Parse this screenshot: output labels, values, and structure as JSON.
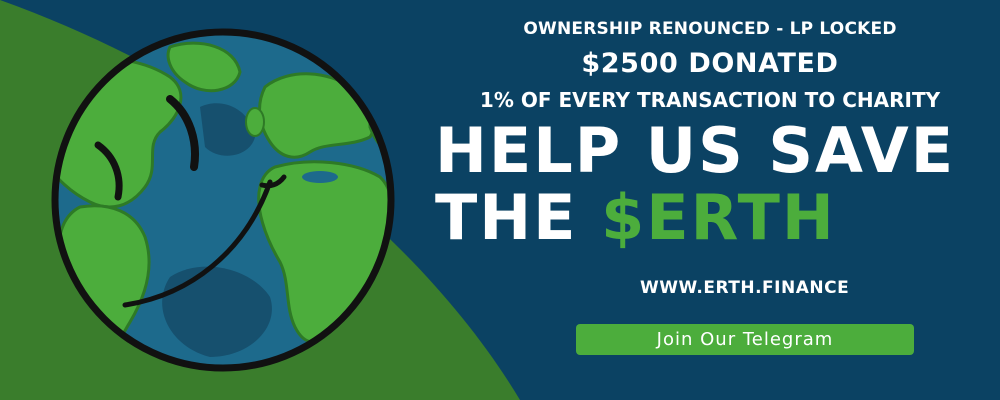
{
  "banner": {
    "ownership_line": "OWNERSHIP RENOUNCED - LP LOCKED",
    "donated_line": "$2500 DONATED",
    "charity_line": "1% OF EVERY TRANSACTION TO CHARITY",
    "headline_line1": "HELP US SAVE",
    "headline_line2_prefix": "THE ",
    "headline_line2_accent": "$ERTH",
    "website_link": "WWW.ERTH.FINANCE",
    "telegram_button": "Join Our Telegram"
  },
  "colors": {
    "background_navy": "#0b4263",
    "background_green": "#3a7d2c",
    "accent_green": "#4cad3c",
    "globe_ocean": "#1d6a8c",
    "globe_land": "#4cad3c",
    "outline_black": "#111111",
    "text_white": "#ffffff"
  },
  "graphics": {
    "globe": "smiling-earth-globe",
    "face": "smiley-face"
  }
}
